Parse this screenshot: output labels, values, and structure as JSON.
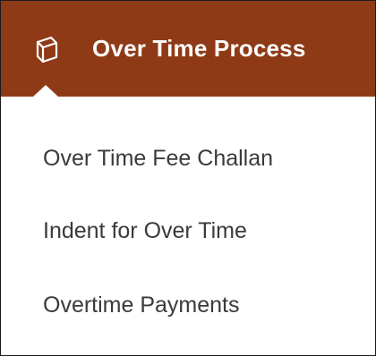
{
  "header": {
    "icon": "box-icon",
    "title": "Over Time Process",
    "background_color": "#8f3a17",
    "text_color": "#ffffff"
  },
  "menu": {
    "items": [
      {
        "label": "Over Time Fee Challan"
      },
      {
        "label": "Indent for Over Time"
      },
      {
        "label": "Overtime Payments"
      }
    ],
    "text_color": "#3a3a3a"
  }
}
